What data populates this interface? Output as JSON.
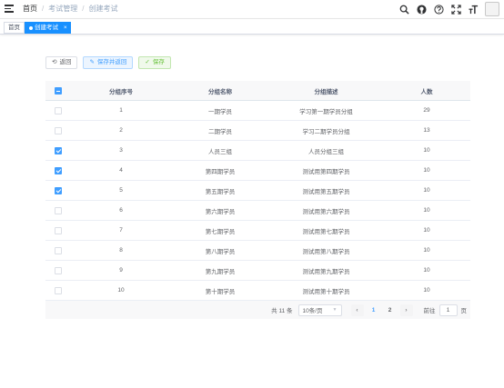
{
  "breadcrumb": [
    "首页",
    "考试管理",
    "创建考试"
  ],
  "tags": {
    "home": "首页",
    "active": "创建考试",
    "close": "×"
  },
  "actions": {
    "back": "返回",
    "save_return": "保存并返回",
    "save": "保存"
  },
  "table": {
    "headers": [
      "分组序号",
      "分组名称",
      "分组描述",
      "人数"
    ],
    "rows": [
      {
        "checked": false,
        "cells": [
          "1",
          "一期学员",
          "学习第一期学员分组",
          "29"
        ]
      },
      {
        "checked": false,
        "cells": [
          "2",
          "二期学员",
          "学习二期学员分组",
          "13"
        ]
      },
      {
        "checked": true,
        "cells": [
          "3",
          "人员三组",
          "人员分组三组",
          "10"
        ]
      },
      {
        "checked": true,
        "cells": [
          "4",
          "第四期学员",
          "测试用第四期学员",
          "10"
        ]
      },
      {
        "checked": true,
        "cells": [
          "5",
          "第五期学员",
          "测试用第五期学员",
          "10"
        ]
      },
      {
        "checked": false,
        "cells": [
          "6",
          "第六期学员",
          "测试用第六期学员",
          "10"
        ]
      },
      {
        "checked": false,
        "cells": [
          "7",
          "第七期学员",
          "测试用第七期学员",
          "10"
        ]
      },
      {
        "checked": false,
        "cells": [
          "8",
          "第八期学员",
          "测试用第八期学员",
          "10"
        ]
      },
      {
        "checked": false,
        "cells": [
          "9",
          "第九期学员",
          "测试用第九期学员",
          "10"
        ]
      },
      {
        "checked": false,
        "cells": [
          "10",
          "第十期学员",
          "测试用第十期学员",
          "10"
        ]
      }
    ]
  },
  "pagination": {
    "total": "共 11 条",
    "page_size": "10条/页",
    "pages": [
      "1",
      "2"
    ],
    "current": "1",
    "goto_label": "前往",
    "goto_value": "1",
    "goto_unit": "页"
  },
  "icons": [
    "hamburger-icon",
    "search-icon",
    "github-icon",
    "help-icon",
    "fullscreen-icon",
    "font-size-icon"
  ],
  "colors": {
    "primary": "#409eff",
    "tag_active": "#1890ff",
    "success": "#67c23a"
  }
}
